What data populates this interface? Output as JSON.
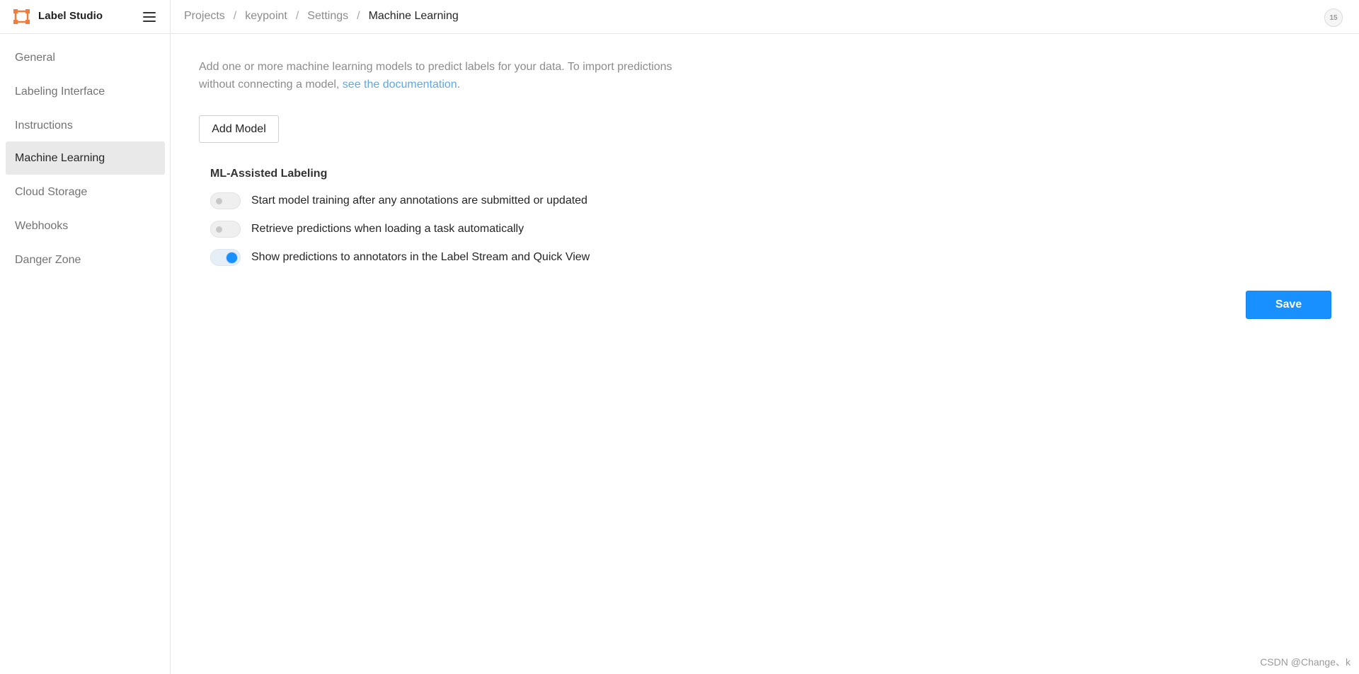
{
  "app": {
    "name": "Label Studio",
    "brand_color": "#f07c3d"
  },
  "header": {
    "breadcrumb": [
      "Projects",
      "keypoint",
      "Settings",
      "Machine Learning"
    ],
    "separator": "/",
    "badge": "15"
  },
  "sidebar": {
    "items": [
      {
        "label": "General"
      },
      {
        "label": "Labeling Interface"
      },
      {
        "label": "Instructions"
      },
      {
        "label": "Machine Learning",
        "active": true
      },
      {
        "label": "Cloud Storage"
      },
      {
        "label": "Webhooks"
      },
      {
        "label": "Danger Zone"
      }
    ]
  },
  "main": {
    "intro_text": "Add one or more machine learning models to predict labels for your data. To import predictions without connecting a model, ",
    "intro_link": "see the documentation",
    "intro_end": ".",
    "add_model_label": "Add Model",
    "section_title": "ML-Assisted Labeling",
    "toggles": [
      {
        "label": "Start model training after any annotations are submitted or updated",
        "on": false
      },
      {
        "label": "Retrieve predictions when loading a task automatically",
        "on": false
      },
      {
        "label": "Show predictions to annotators in the Label Stream and Quick View",
        "on": true
      }
    ],
    "save_label": "Save"
  },
  "colors": {
    "accent": "#1890ff",
    "link": "#5fa8e8"
  },
  "watermark": "CSDN @Change、k"
}
